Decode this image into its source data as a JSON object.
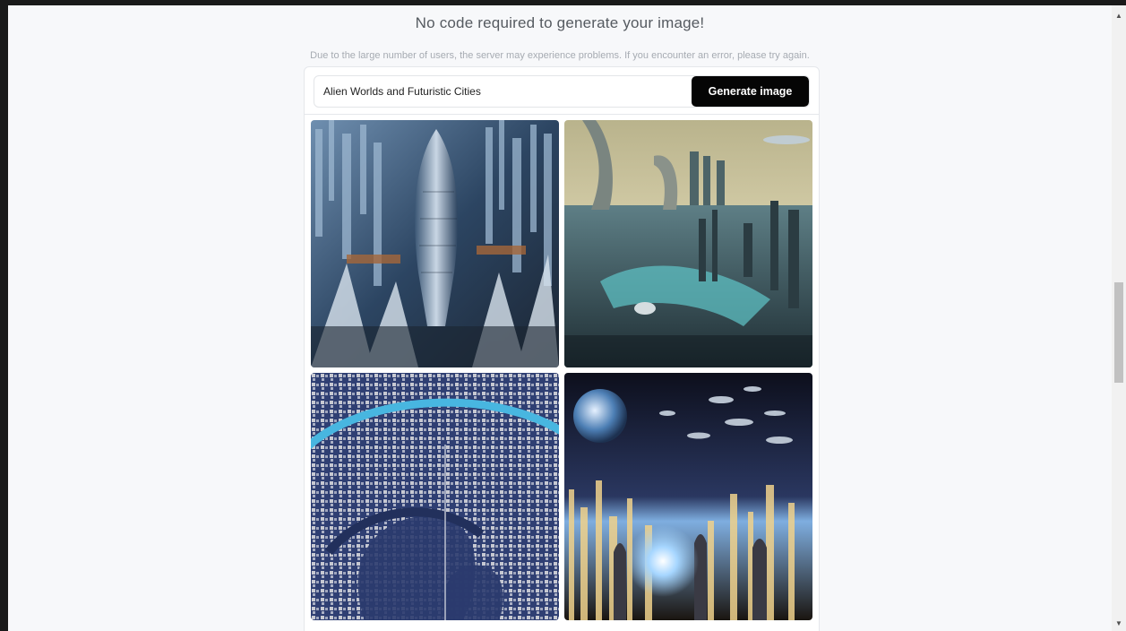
{
  "page": {
    "headline": "No code required to generate your image!",
    "notice": "Due to the large number of users, the server may experience problems. If you encounter an error, please try again."
  },
  "generator": {
    "prompt_value": "Alien Worlds and Futuristic Cities",
    "generate_label": "Generate image"
  },
  "gallery": {
    "images": [
      {
        "subject": "aerial view of futuristic skyscraper city with tall spire"
      },
      {
        "subject": "futuristic city with curved towers and flying ships over teal water"
      },
      {
        "subject": "circular aerial map-like city with blue river ring"
      },
      {
        "subject": "night city with glowing lights, planet and flying saucers in sky"
      }
    ]
  },
  "colors": {
    "page_bg": "#f7f8fa",
    "button_bg": "#050505",
    "button_text": "#ffffff",
    "headline_text": "#555a60",
    "notice_text": "#a6abb2"
  }
}
